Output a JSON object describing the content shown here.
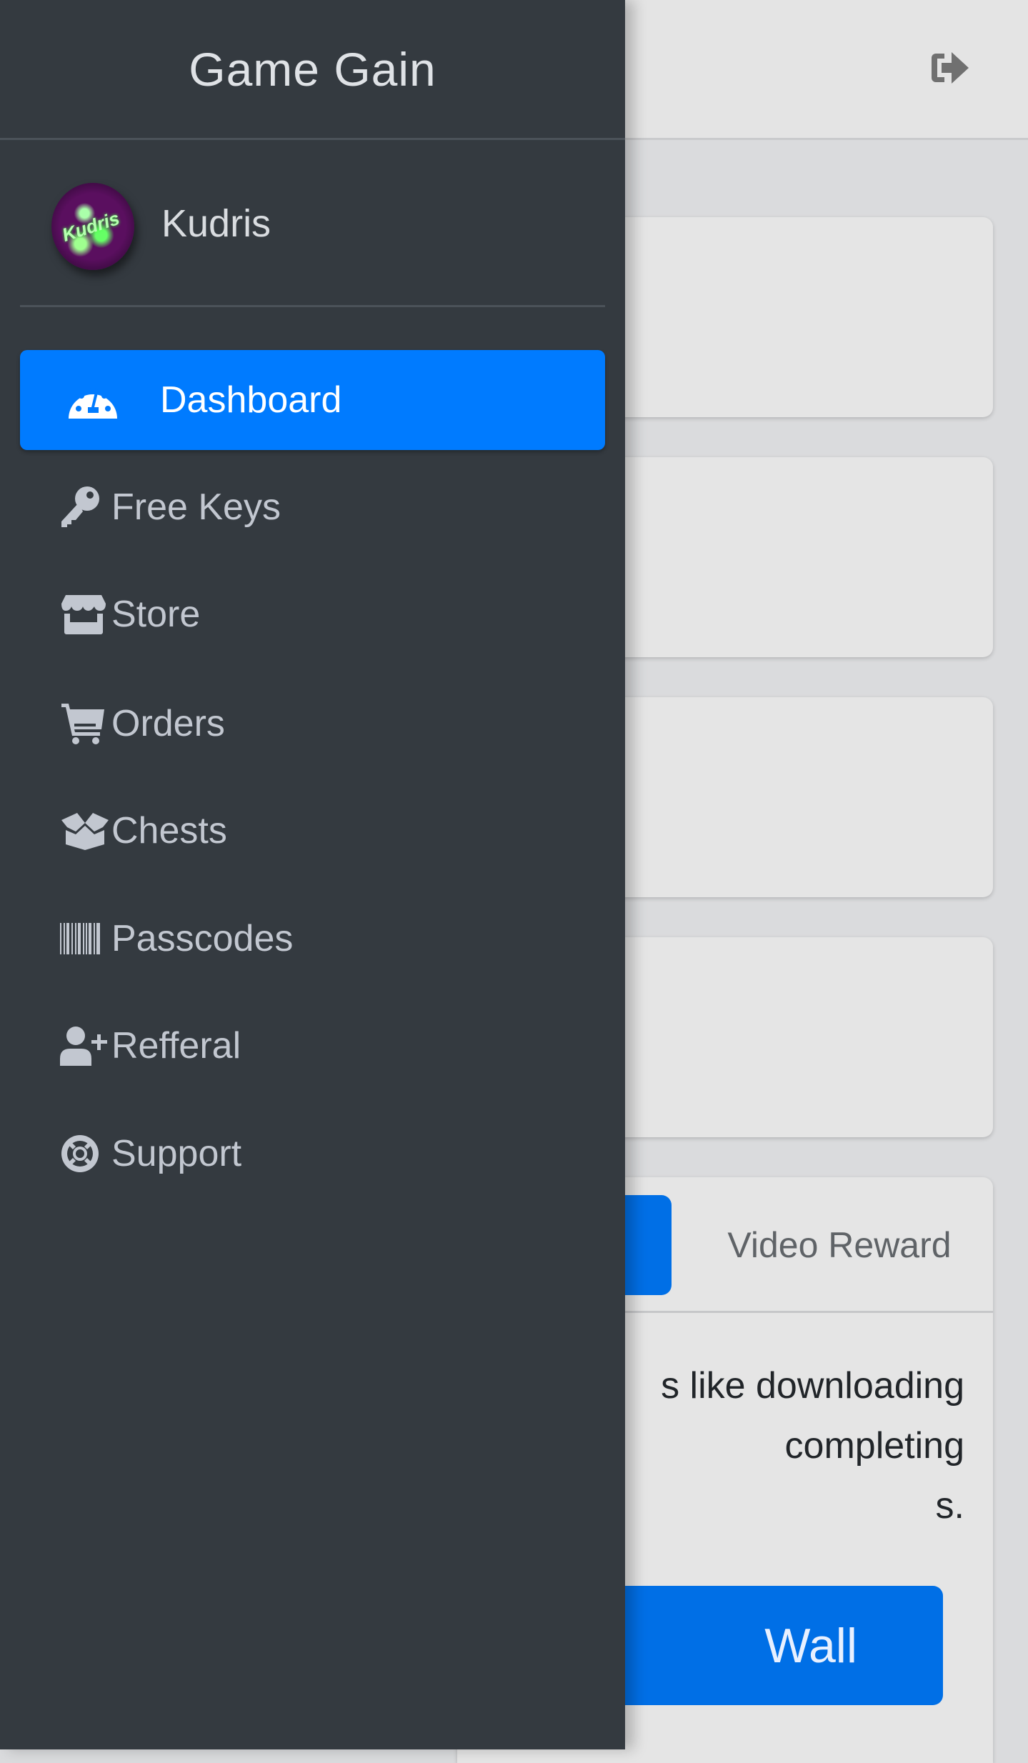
{
  "app": {
    "title": "Game Gain"
  },
  "topbar": {
    "logout_icon": "sign-out-icon"
  },
  "user": {
    "name": "Kudris",
    "avatar_text": "Kudris"
  },
  "sidebar": {
    "items": [
      {
        "label": "Dashboard",
        "icon": "tachometer-icon",
        "active": true
      },
      {
        "label": "Free Keys",
        "icon": "key-icon",
        "active": false
      },
      {
        "label": "Store",
        "icon": "store-icon",
        "active": false
      },
      {
        "label": "Orders",
        "icon": "shopping-cart-icon",
        "active": false
      },
      {
        "label": "Chests",
        "icon": "box-open-icon",
        "active": false
      },
      {
        "label": "Passcodes",
        "icon": "barcode-icon",
        "active": false
      },
      {
        "label": "Refferal",
        "icon": "user-plus-icon",
        "active": false
      },
      {
        "label": "Support",
        "icon": "life-ring-icon",
        "active": false
      }
    ]
  },
  "main": {
    "tabs": [
      {
        "label": "",
        "active": true
      },
      {
        "label": "Video Reward",
        "active": false
      }
    ],
    "description_lines": [
      "s like downloading",
      "completing",
      "s."
    ],
    "action_button_label": "Wall"
  },
  "colors": {
    "sidebar_bg": "#343a40",
    "accent": "#007bff",
    "button_blue": "#006fe6",
    "sidebar_text": "#c2c7d0",
    "content_bg": "#dadbdd",
    "card_bg": "#e5e5e5"
  }
}
